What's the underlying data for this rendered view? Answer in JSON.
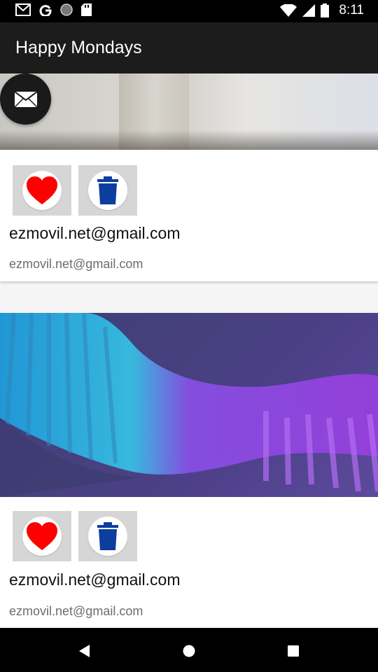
{
  "status_bar": {
    "time": "8:11",
    "left_icons": [
      "gmail-icon",
      "google-icon",
      "circle-icon",
      "sd-card-icon"
    ],
    "right_icons": [
      "wifi-icon",
      "signal-icon",
      "battery-icon"
    ]
  },
  "app_bar": {
    "title": "Happy Mondays"
  },
  "fab": {
    "icon": "mail-icon"
  },
  "cards": [
    {
      "image": "photo-card-1",
      "like_icon": "heart-icon",
      "delete_icon": "trash-icon",
      "title": "ezmovil.net@gmail.com",
      "subtitle": "ezmovil.net@gmail.com"
    },
    {
      "image": "photo-card-2",
      "like_icon": "heart-icon",
      "delete_icon": "trash-icon",
      "title": "ezmovil.net@gmail.com",
      "subtitle": "ezmovil.net@gmail.com"
    }
  ],
  "nav_bar": {
    "buttons": [
      "back-icon",
      "home-icon",
      "recents-icon"
    ]
  },
  "colors": {
    "heart": "#ff0000",
    "trash": "#0d3d9e",
    "app_bar": "#1c1c1c",
    "fab": "#1a1a1a"
  }
}
